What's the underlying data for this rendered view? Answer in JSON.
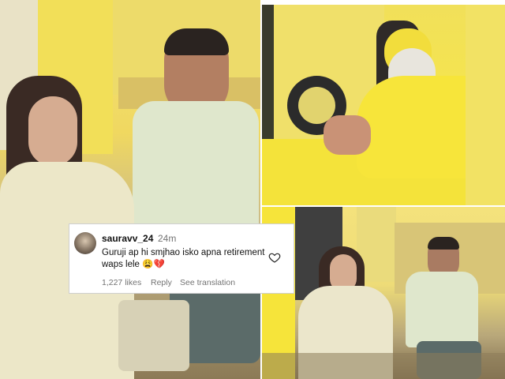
{
  "comment": {
    "username": "sauravv_24",
    "timestamp": "24m",
    "text": "Guruji ap hi smjhao isko apna retirement waps lele 😩💔",
    "likes": "1,227 likes",
    "reply_label": "Reply",
    "translation_label": "See translation"
  },
  "colors": {
    "background_yellow": "#f1dc52",
    "robe_yellow": "#f7e23a",
    "card_background": "#ffffff",
    "meta_text": "#737373"
  },
  "icons": {
    "avatar": "user-avatar",
    "like": "heart-outline-icon"
  }
}
